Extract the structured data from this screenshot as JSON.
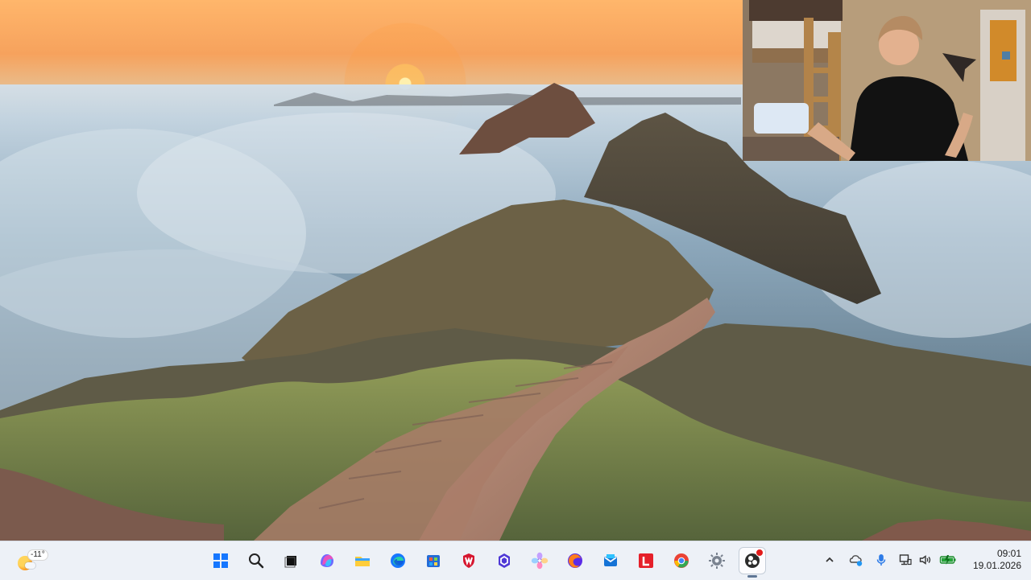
{
  "desktop": {
    "wallpaper": "mountain-sunrise-wallpaper"
  },
  "overlay": {
    "webcam": "presenter-webcam-overlay"
  },
  "taskbar": {
    "weather": {
      "temperature": "-11°",
      "icon": "weather-icon"
    },
    "pinned": [
      {
        "name": "start-button",
        "icon": "windows-logo-icon"
      },
      {
        "name": "search-button",
        "icon": "search-icon"
      },
      {
        "name": "task-view-button",
        "icon": "task-view-icon"
      },
      {
        "name": "copilot-button",
        "icon": "copilot-icon"
      },
      {
        "name": "file-explorer-button",
        "icon": "folder-icon"
      },
      {
        "name": "edge-button",
        "icon": "edge-icon"
      },
      {
        "name": "store-button",
        "icon": "store-icon"
      },
      {
        "name": "mcafee-button",
        "icon": "shield-icon"
      },
      {
        "name": "vpn-button",
        "icon": "hexagon-app-icon"
      },
      {
        "name": "flower-app-button",
        "icon": "flower-icon"
      },
      {
        "name": "firefox-button",
        "icon": "firefox-icon"
      },
      {
        "name": "mail-button",
        "icon": "mail-icon"
      },
      {
        "name": "l-app-button",
        "icon": "letter-l-icon"
      },
      {
        "name": "chrome-button",
        "icon": "chrome-icon"
      },
      {
        "name": "settings-button",
        "icon": "gear-icon"
      },
      {
        "name": "obs-button",
        "icon": "obs-icon",
        "active": true,
        "badge": true
      }
    ],
    "tray": [
      {
        "name": "hidden-icons-button",
        "icon": "chevron-up-icon"
      },
      {
        "name": "onedrive-tray-button",
        "icon": "cloud-sync-icon"
      },
      {
        "name": "microphone-tray-button",
        "icon": "microphone-icon"
      },
      {
        "name": "network-tray-button",
        "icon": "network-icon"
      },
      {
        "name": "volume-tray-button",
        "icon": "speaker-icon"
      },
      {
        "name": "battery-tray-button",
        "icon": "battery-icon"
      }
    ],
    "clock": {
      "time": "09:01",
      "date": "19.01.2026"
    },
    "colors": {
      "background": "#edf1f7",
      "active_indicator": "#5f7695",
      "notification_badge": "#e21b1b"
    }
  }
}
